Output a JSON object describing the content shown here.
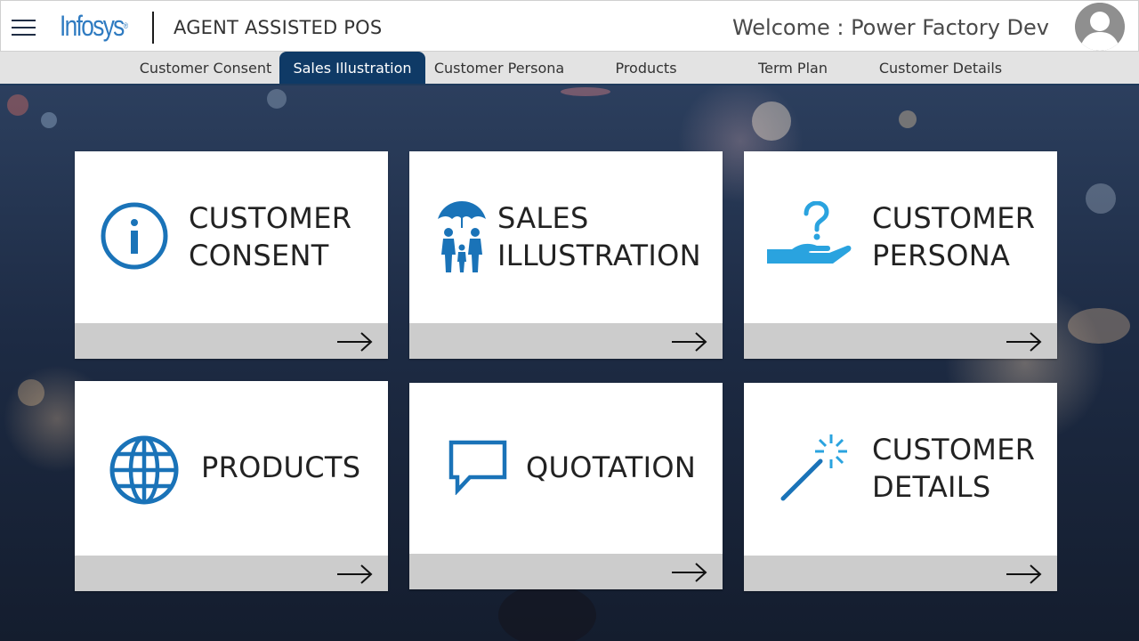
{
  "header": {
    "logo_text": "Infosys",
    "logo_mark": "®",
    "app_title": "AGENT ASSISTED POS",
    "welcome_text": "Welcome : Power Factory Dev",
    "menu_icon": "hamburger-menu-icon",
    "avatar_icon": "user-avatar-icon"
  },
  "tabs": [
    {
      "label": "Customer Consent",
      "active": false
    },
    {
      "label": "Sales Illustration",
      "active": true
    },
    {
      "label": "Customer Persona",
      "active": false
    },
    {
      "label": "Products",
      "active": false
    },
    {
      "label": "Term Plan",
      "active": false
    },
    {
      "label": "Customer Details",
      "active": false
    }
  ],
  "cards": [
    {
      "line1": "CUSTOMER",
      "line2": "CONSENT",
      "icon": "info-icon"
    },
    {
      "line1": "SALES",
      "line2": "ILLUSTRATION",
      "icon": "family-umbrella-icon"
    },
    {
      "line1": "CUSTOMER",
      "line2": "PERSONA",
      "icon": "hand-question-icon"
    },
    {
      "line1": "PRODUCTS",
      "icon": "globe-icon"
    },
    {
      "line1": "QUOTATION",
      "icon": "speech-bubble-icon"
    },
    {
      "line1": "CUSTOMER",
      "line2": "DETAILS",
      "icon": "magic-wand-icon"
    }
  ],
  "colors": {
    "brand_blue": "#2f7bc1",
    "icon_blue": "#1a73b8",
    "icon_light_blue": "#2aa3df",
    "active_tab": "#0f3a66",
    "card_footer": "#cccccc"
  }
}
